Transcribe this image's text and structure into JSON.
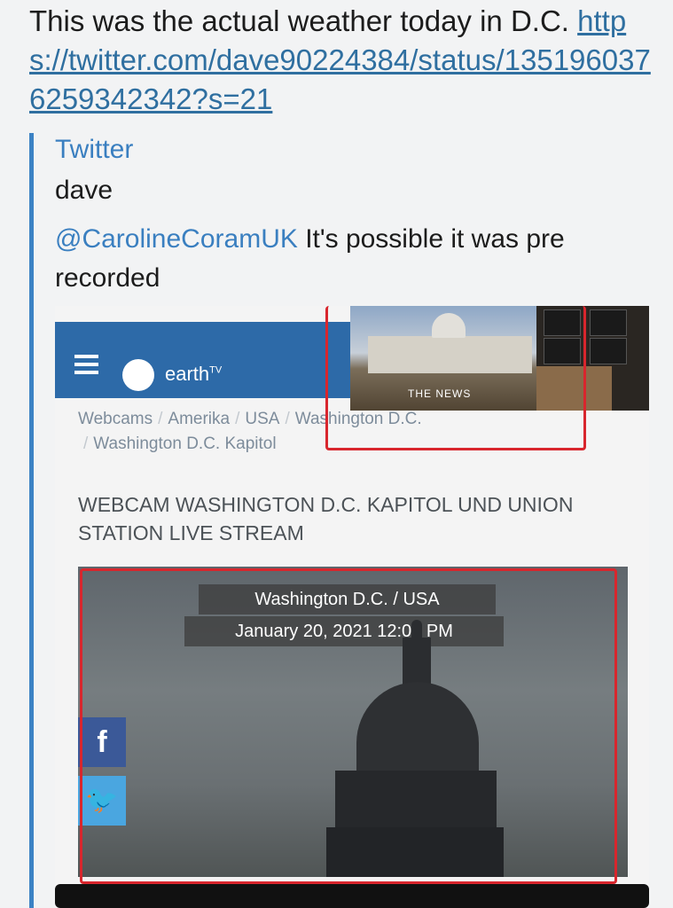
{
  "message": {
    "text": "This was the actual weather today in D.C.",
    "link": "https://twitter.com/dave90224384/status/1351960376259342342?s=21"
  },
  "preview": {
    "site_name": "Twitter",
    "title": "dave",
    "mention": "@CarolineCoramUK",
    "description": " It's possible it was pre recorded"
  },
  "screenshot": {
    "logo": "earth",
    "logo_superscript": "TV",
    "thumbnail_banner": "THE NEWS",
    "breadcrumb": [
      "Webcams",
      "Amerika",
      "USA",
      "Washington D.C.",
      "Washington D.C. Kapitol"
    ],
    "heading": "WEBCAM WASHINGTON D.C. KAPITOL UND UNION STATION LIVE STREAM",
    "cam_location": "Washington D.C. / USA",
    "cam_datetime": "January 20, 2021 12:02 PM",
    "facebook_glyph": "f",
    "twitter_glyph": "🐦",
    "annotation_color": "#d8262d"
  }
}
